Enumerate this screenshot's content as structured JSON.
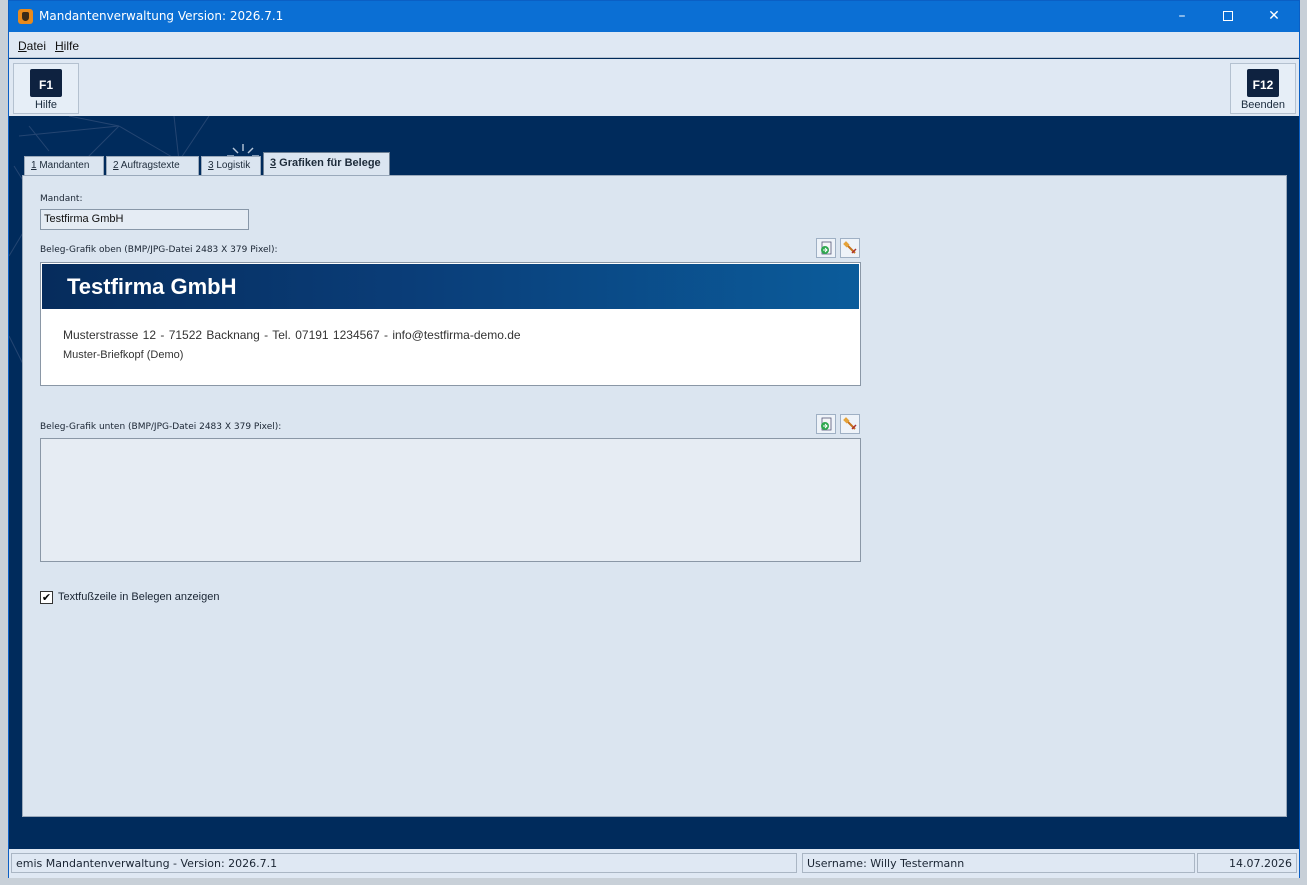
{
  "window": {
    "title": "Mandantenverwaltung Version: 2026.7.1",
    "controls": {
      "minimize": "–",
      "maximize": "",
      "close": "✕"
    }
  },
  "menu": {
    "datei": {
      "first": "D",
      "rest": "atei"
    },
    "hilfe": {
      "first": "H",
      "rest": "ilfe"
    }
  },
  "toolbar": {
    "help": {
      "key": "F1",
      "label": "Hilfe"
    },
    "exit": {
      "key": "F12",
      "label": "Beenden"
    }
  },
  "tabs": [
    {
      "num": "1",
      "label": " Mandanten"
    },
    {
      "num": "2",
      "label": " Auftragstexte"
    },
    {
      "num": "3",
      "label": " Logistik"
    },
    {
      "num": "3",
      "label": " Grafiken für Belege"
    }
  ],
  "form": {
    "mandant_label": "Mandant:",
    "mandant_value": "Testfirma GmbH",
    "top_label": "Beleg-Grafik oben (BMP/JPG-Datei 2483 X 379 Pixel):",
    "bottom_label": "Beleg-Grafik unten (BMP/JPG-Datei 2483 X 379 Pixel):",
    "letterhead": {
      "company": "Testfirma GmbH",
      "line1": "Musterstrasse 12   -   71522 Backnang   -   Tel. 07191 1234567   -   info@testfirma-demo.de",
      "line2": "Muster-Briefkopf (Demo)"
    },
    "checkbox_label": "Textfußzeile in Belegen anzeigen",
    "checkbox_checked": true,
    "check_mark": "✔"
  },
  "status": {
    "left": "emis Mandantenverwaltung - Version: 2026.7.1",
    "middle": "Username: Willy Testermann",
    "right": "14.07.2026"
  },
  "icons": {
    "load": "load-image-icon",
    "clear": "clear-image-icon"
  },
  "colors": {
    "title_bar": "#0b6fd4",
    "dark_area": "#002b5c",
    "panel": "#dbe5f0",
    "letterhead_band": "#0a3d78"
  }
}
